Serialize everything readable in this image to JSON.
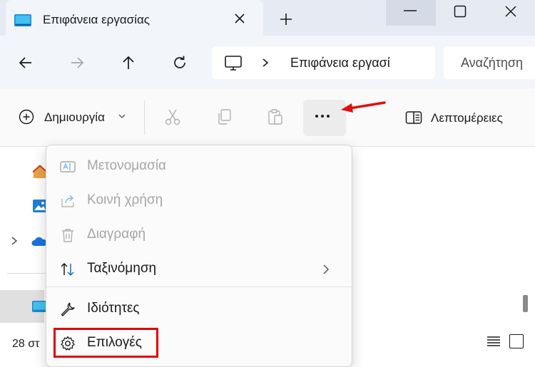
{
  "window": {
    "tab_title": "Επιφάνεια εργασίας",
    "tab_icon": "desktop-folder-icon",
    "new_tab_icon": "plus-icon",
    "controls": [
      "minimize-icon",
      "maximize-icon",
      "close-icon"
    ]
  },
  "navigation": {
    "buttons": [
      "back-arrow-icon",
      "forward-arrow-icon",
      "up-arrow-icon",
      "refresh-icon"
    ],
    "address": {
      "root_icon": "computer-icon",
      "path_text": "Επιφάνεια εργασί"
    },
    "search_placeholder": "Αναζήτηση"
  },
  "command_bar": {
    "create_label": "Δημιουργία",
    "cut_icon": "scissors-icon",
    "copy_icon": "copy-icon",
    "paste_icon": "clipboard-icon",
    "more_icon": "more-dots-icon",
    "details_label": "Λεπτομέρειες"
  },
  "context_menu": {
    "items": [
      {
        "label": "Μετονομασία",
        "icon": "rename-icon",
        "enabled": false
      },
      {
        "label": "Κοινή χρήση",
        "icon": "share-icon",
        "enabled": false
      },
      {
        "label": "Διαγραφή",
        "icon": "trash-icon",
        "enabled": false
      },
      {
        "label": "Ταξινόμηση",
        "icon": "sort-icon",
        "enabled": true,
        "submenu": true
      },
      {
        "label": "Ιδιότητες",
        "icon": "wrench-icon",
        "enabled": true
      },
      {
        "label": "Επιλογές",
        "icon": "gear-icon",
        "enabled": true,
        "highlighted": true
      }
    ]
  },
  "sidebar": {
    "icons": [
      "home-icon",
      "gallery-icon",
      "onedrive-cloud-icon",
      "desktop-icon"
    ]
  },
  "status_bar": {
    "item_count": "28 στ"
  },
  "colors": {
    "highlight_red": "#e00000",
    "annotation_arrow": "#e01010",
    "accent_blue": "#0078d4"
  }
}
